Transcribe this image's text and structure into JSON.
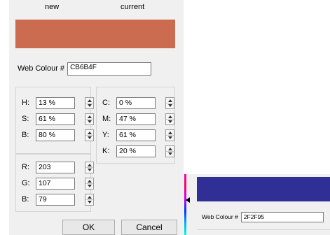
{
  "picker": {
    "new_label": "new",
    "current_label": "current",
    "new_color": "#CB6B4F",
    "web_label": "Web Colour #",
    "web_value": "CB6B4F",
    "hsb": [
      {
        "label": "H:",
        "value": "13 %"
      },
      {
        "label": "S:",
        "value": "61 %"
      },
      {
        "label": "B:",
        "value": "80 %"
      }
    ],
    "cmyk": [
      {
        "label": "C:",
        "value": "0 %"
      },
      {
        "label": "M:",
        "value": "47 %"
      },
      {
        "label": "Y:",
        "value": "61 %"
      },
      {
        "label": "K:",
        "value": "20 %"
      }
    ],
    "rgb": [
      {
        "label": "R:",
        "value": "203"
      },
      {
        "label": "G:",
        "value": "107"
      },
      {
        "label": "B:",
        "value": "79"
      }
    ],
    "ok_label": "OK",
    "cancel_label": "Cancel"
  },
  "background_picker": {
    "color": "#2F2F95",
    "web_label": "Web Colour #",
    "web_value": "2F2F95"
  }
}
